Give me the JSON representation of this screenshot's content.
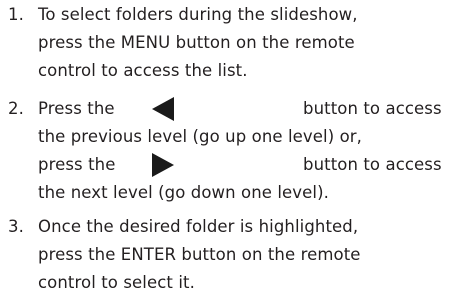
{
  "steps": [
    {
      "number": "1.",
      "lines": [
        "To select folders during the slideshow,",
        "press the MENU button on the remote",
        "control to access the list."
      ]
    },
    {
      "number": "2.",
      "line1_pre": "Press the",
      "line1_post": "button to access",
      "line2": "the previous level (go up one level) or,",
      "line3_pre": "press the",
      "line3_post": "button to access",
      "line4": "the next level (go down one level).",
      "left_icon": "left-triangle-icon",
      "right_icon": "right-triangle-icon"
    },
    {
      "number": "3.",
      "lines": [
        "Once the desired folder is highlighted,",
        "press the ENTER button on the remote",
        "control to select it."
      ]
    }
  ]
}
